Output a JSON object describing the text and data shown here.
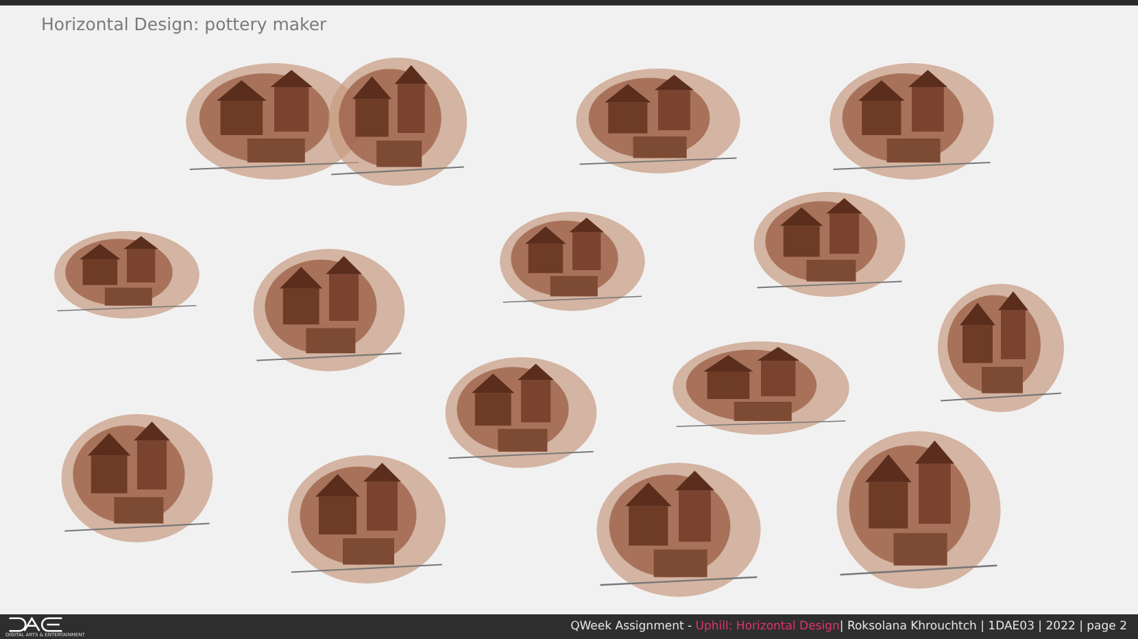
{
  "title": "Horizontal Design: pottery maker",
  "sketches": [
    {
      "kind": "painting"
    },
    {
      "kind": "painting"
    },
    {
      "kind": "painting"
    },
    {
      "kind": "painting"
    },
    {
      "kind": "painting"
    },
    {
      "kind": "painting"
    },
    {
      "kind": "painting"
    },
    {
      "kind": "painting"
    },
    {
      "kind": "painting"
    },
    {
      "kind": "painting"
    },
    {
      "kind": "painting"
    },
    {
      "kind": "painting"
    },
    {
      "kind": "painting"
    },
    {
      "kind": "painting"
    },
    {
      "kind": "painting"
    }
  ],
  "footer": {
    "logo_caption": "DIGITAL ARTS & ENTERTAINMENT",
    "credits": [
      {
        "text": "QWeek Assignment - ",
        "highlight": false
      },
      {
        "text": "Uphill: Horizontal Design",
        "highlight": true
      },
      {
        "text": "| Roksolana Khrouchtch | 1DAE03 | 2022 | page 2",
        "highlight": false
      }
    ]
  }
}
